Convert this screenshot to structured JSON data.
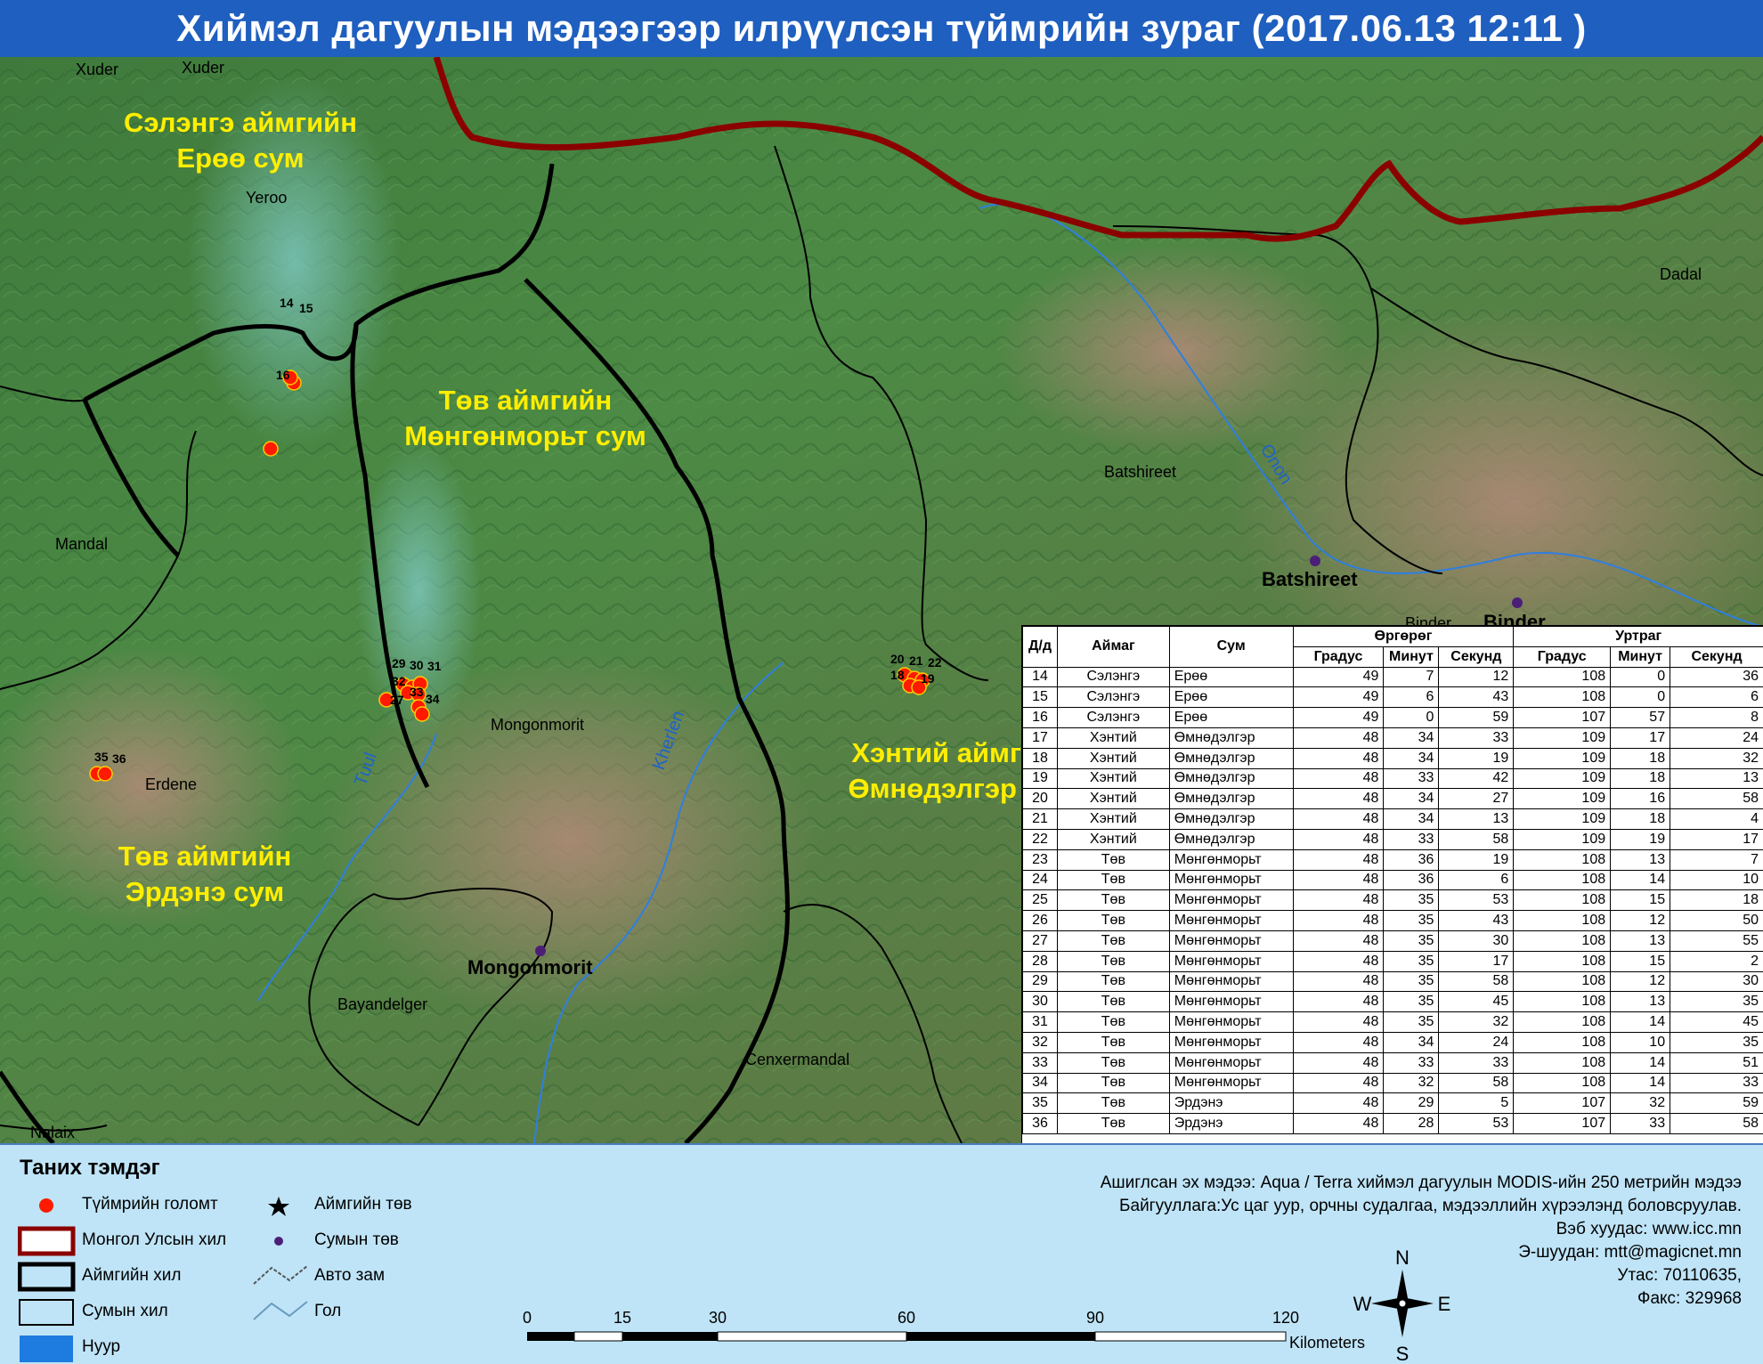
{
  "title": "Хиймэл дагуулын мэдээгээр илрүүлсэн түймрийн зураг  (2017.06.13  12:11 )",
  "map": {
    "region_labels": [
      {
        "line1": "Сэлэнгэ аймгийн",
        "line2": "Ерөө сум"
      },
      {
        "line1": "Төв аймгийн",
        "line2": "Мөнгөнморьт сум"
      },
      {
        "line1": "Төв аймгийн",
        "line2": "Эрдэнэ сум"
      },
      {
        "line1": "Хэнтий аймгийн",
        "line2": "Өмнөдэлгэр сум"
      }
    ],
    "place_labels": [
      "Xuder",
      "Xuder",
      "Yeroo",
      "Mandal",
      "Erdene",
      "Mongonmorit",
      "Bayandelger",
      "Cenxermandal",
      "Batshireet",
      "Dadal",
      "Binder",
      "Nalaix"
    ],
    "sum_centers": [
      "Batshireet",
      "Binder",
      "Mongonmorit"
    ],
    "rivers": [
      "Onon",
      "Tuul",
      "Kherlen"
    ],
    "fire_labels": [
      "14",
      "15",
      "16",
      "29",
      "30",
      "31",
      "32",
      "33",
      "27",
      "34",
      "35",
      "36",
      "20",
      "21",
      "22",
      "18",
      "19"
    ]
  },
  "table": {
    "headers": {
      "id": "Д/д",
      "aimag": "Аймаг",
      "sum": "Сум",
      "lat_group": "Өргөрөг",
      "lon_group": "Уртраг",
      "deg": "Градус",
      "min": "Минут",
      "sec": "Секунд"
    },
    "rows": [
      [
        "14",
        "Сэлэнгэ",
        "Ерөө",
        "49",
        "7",
        "12",
        "108",
        "0",
        "36"
      ],
      [
        "15",
        "Сэлэнгэ",
        "Ерөө",
        "49",
        "6",
        "43",
        "108",
        "0",
        "6"
      ],
      [
        "16",
        "Сэлэнгэ",
        "Ерөө",
        "49",
        "0",
        "59",
        "107",
        "57",
        "8"
      ],
      [
        "17",
        "Хэнтий",
        "Өмнөдэлгэр",
        "48",
        "34",
        "33",
        "109",
        "17",
        "24"
      ],
      [
        "18",
        "Хэнтий",
        "Өмнөдэлгэр",
        "48",
        "34",
        "19",
        "109",
        "18",
        "32"
      ],
      [
        "19",
        "Хэнтий",
        "Өмнөдэлгэр",
        "48",
        "33",
        "42",
        "109",
        "18",
        "13"
      ],
      [
        "20",
        "Хэнтий",
        "Өмнөдэлгэр",
        "48",
        "34",
        "27",
        "109",
        "16",
        "58"
      ],
      [
        "21",
        "Хэнтий",
        "Өмнөдэлгэр",
        "48",
        "34",
        "13",
        "109",
        "18",
        "4"
      ],
      [
        "22",
        "Хэнтий",
        "Өмнөдэлгэр",
        "48",
        "33",
        "58",
        "109",
        "19",
        "17"
      ],
      [
        "23",
        "Төв",
        "Мөнгөнморьт",
        "48",
        "36",
        "19",
        "108",
        "13",
        "7"
      ],
      [
        "24",
        "Төв",
        "Мөнгөнморьт",
        "48",
        "36",
        "6",
        "108",
        "14",
        "10"
      ],
      [
        "25",
        "Төв",
        "Мөнгөнморьт",
        "48",
        "35",
        "53",
        "108",
        "15",
        "18"
      ],
      [
        "26",
        "Төв",
        "Мөнгөнморьт",
        "48",
        "35",
        "43",
        "108",
        "12",
        "50"
      ],
      [
        "27",
        "Төв",
        "Мөнгөнморьт",
        "48",
        "35",
        "30",
        "108",
        "13",
        "55"
      ],
      [
        "28",
        "Төв",
        "Мөнгөнморьт",
        "48",
        "35",
        "17",
        "108",
        "15",
        "2"
      ],
      [
        "29",
        "Төв",
        "Мөнгөнморьт",
        "48",
        "35",
        "58",
        "108",
        "12",
        "30"
      ],
      [
        "30",
        "Төв",
        "Мөнгөнморьт",
        "48",
        "35",
        "45",
        "108",
        "13",
        "35"
      ],
      [
        "31",
        "Төв",
        "Мөнгөнморьт",
        "48",
        "35",
        "32",
        "108",
        "14",
        "45"
      ],
      [
        "32",
        "Төв",
        "Мөнгөнморьт",
        "48",
        "34",
        "24",
        "108",
        "10",
        "35"
      ],
      [
        "33",
        "Төв",
        "Мөнгөнморьт",
        "48",
        "33",
        "33",
        "108",
        "14",
        "51"
      ],
      [
        "34",
        "Төв",
        "Мөнгөнморьт",
        "48",
        "32",
        "58",
        "108",
        "14",
        "33"
      ],
      [
        "35",
        "Төв",
        "Эрдэнэ",
        "48",
        "29",
        "5",
        "107",
        "32",
        "59"
      ],
      [
        "36",
        "Төв",
        "Эрдэнэ",
        "48",
        "28",
        "53",
        "107",
        "33",
        "58"
      ]
    ]
  },
  "legend": {
    "title": "Таних тэмдэг",
    "fire": "Түймрийн голомт",
    "border_country": "Монгол Улсын хил",
    "border_aimag": "Аймгийн хил",
    "border_sum": "Сумын хил",
    "lake": "Нуур",
    "aimag_center": "Аймгийн төв",
    "sum_center": "Сумын төв",
    "road": "Авто зам",
    "river": "Гол"
  },
  "scale": {
    "ticks": [
      "0",
      "15",
      "30",
      "60",
      "90",
      "120"
    ],
    "unit": "Kilometers"
  },
  "compass": {
    "n": "N",
    "s": "S",
    "e": "E",
    "w": "W"
  },
  "info": {
    "line1": "Ашиглсан эх мэдээ: Aqua / Terra хиймэл дагуулын MODIS-ийн 250 метрийн мэдээ",
    "line2": "Байгууллага:Ус цаг уур, орчны судалгаа, мэдээллийн хүрээлэнд боловсруулав.",
    "line3": "Вэб хуудас: www.icc.mn",
    "line4": "Э-шуудан: mtt@magicnet.mn",
    "line5": "Утас: 70110635,",
    "line6": "Факс: 329968"
  },
  "colors": {
    "title_bg": "#1e5fbf",
    "country_border": "#8b0000",
    "aimag_border": "#000000",
    "fire": "#ff1a00",
    "region_label": "#ffee00",
    "river": "#2f7fe0",
    "legend_bg": "#bfe4f7"
  }
}
